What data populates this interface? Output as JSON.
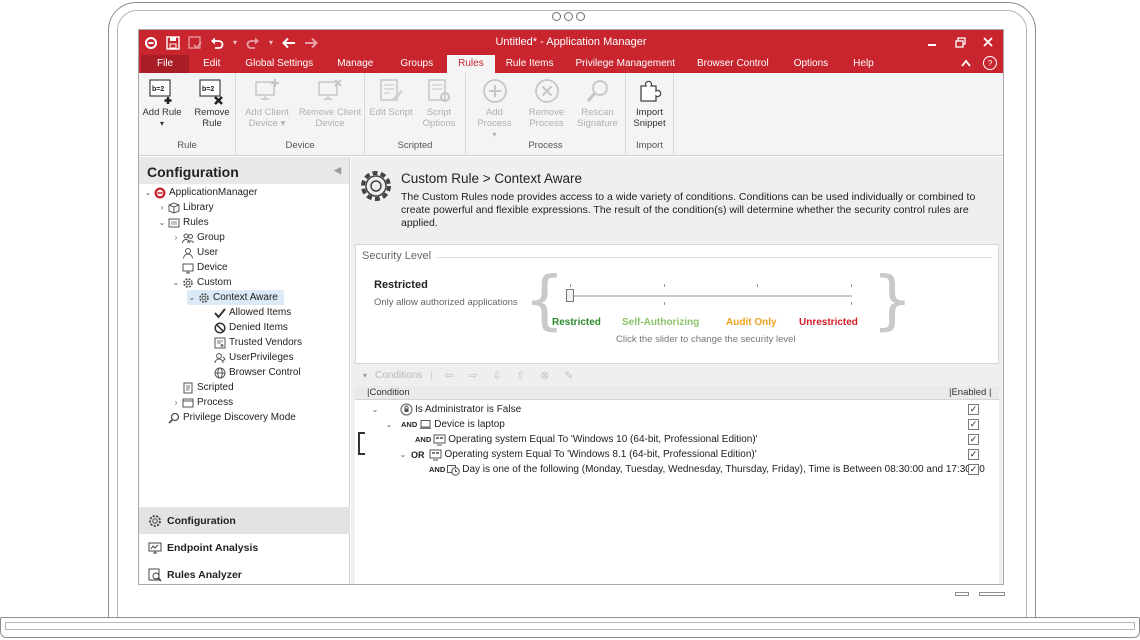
{
  "window": {
    "title": "Untitled* - Application Manager"
  },
  "menu": {
    "tabs": [
      "File",
      "Edit",
      "Global Settings",
      "Manage",
      "Groups",
      "Rules",
      "Rule Items",
      "Privilege Management",
      "Browser Control",
      "Options",
      "Help"
    ],
    "active": "Rules"
  },
  "ribbon": {
    "rule": {
      "name": "Rule",
      "add": [
        "Add Rule",
        ""
      ],
      "remove": [
        "Remove",
        "Rule"
      ],
      "add_icon_text": "b=2",
      "remove_icon_text": "b=2"
    },
    "device": {
      "name": "Device",
      "add": [
        "Add Client",
        "Device"
      ],
      "remove": [
        "Remove Client",
        "Device"
      ]
    },
    "scripted": {
      "name": "Scripted",
      "edit": [
        "Edit Script",
        ""
      ],
      "options": [
        "Script",
        "Options"
      ]
    },
    "process": {
      "name": "Process",
      "add": [
        "Add Process",
        ""
      ],
      "remove": [
        "Remove",
        "Process"
      ],
      "rescan": [
        "Rescan",
        "Signature"
      ]
    },
    "import": {
      "name": "Import",
      "snippet": [
        "Import",
        "Snippet"
      ]
    }
  },
  "left": {
    "title": "Configuration",
    "tree": {
      "root": "ApplicationManager",
      "library": "Library",
      "rules": "Rules",
      "group": "Group",
      "user": "User",
      "device": "Device",
      "custom": "Custom",
      "context_aware": "Context Aware",
      "allowed": "Allowed Items",
      "denied": "Denied Items",
      "trusted": "Trusted Vendors",
      "userpriv": "UserPrivileges",
      "browser": "Browser Control",
      "scripted": "Scripted",
      "process": "Process",
      "privdisc": "Privilege Discovery Mode"
    },
    "nav": {
      "configuration": "Configuration",
      "endpoint": "Endpoint Analysis",
      "analyzer": "Rules Analyzer"
    }
  },
  "header": {
    "title": "Custom Rule > Context Aware",
    "description": "The Custom Rules node provides access to a wide variety of conditions. Conditions can be used individually or combined to create powerful and flexible expressions. The result of the condition(s) will determine whether the security control rules are applied."
  },
  "security": {
    "label": "Security Level",
    "level": "Restricted",
    "level_desc": "Only allow authorized applications",
    "slider_value": "Restricted",
    "levels": [
      {
        "label": "Restricted",
        "color": "#2e8b2e"
      },
      {
        "label": "Self-Authorizing",
        "color": "#8cc26b"
      },
      {
        "label": "Audit Only",
        "color": "#f0a020"
      },
      {
        "label": "Unrestricted",
        "color": "#d01f25"
      }
    ],
    "hint": "Click the slider to change the security level"
  },
  "conditions": {
    "toolbar_label": "Conditions",
    "col_condition": "Condition",
    "col_enabled": "Enabled",
    "rows": [
      {
        "op": "",
        "text": "Is Administrator is False",
        "enabled": true
      },
      {
        "op": "AND",
        "text": "Device is laptop",
        "enabled": true
      },
      {
        "op": "AND",
        "text": "Operating system Equal To 'Windows 10 (64-bit, Professional Edition)'",
        "enabled": true
      },
      {
        "op": "OR",
        "text": "Operating system Equal To 'Windows 8.1 (64-bit, Professional Edition)'",
        "enabled": true
      },
      {
        "op": "AND",
        "text": "Day is one of the following (Monday, Tuesday, Wednesday, Thursday, Friday), Time is Between 08:30:00 and 17:30:00",
        "enabled": true
      }
    ]
  },
  "colors": {
    "accent": "#c8252f",
    "ribbon_bg": "#f4f4f4",
    "pane_bg": "#efefef"
  }
}
